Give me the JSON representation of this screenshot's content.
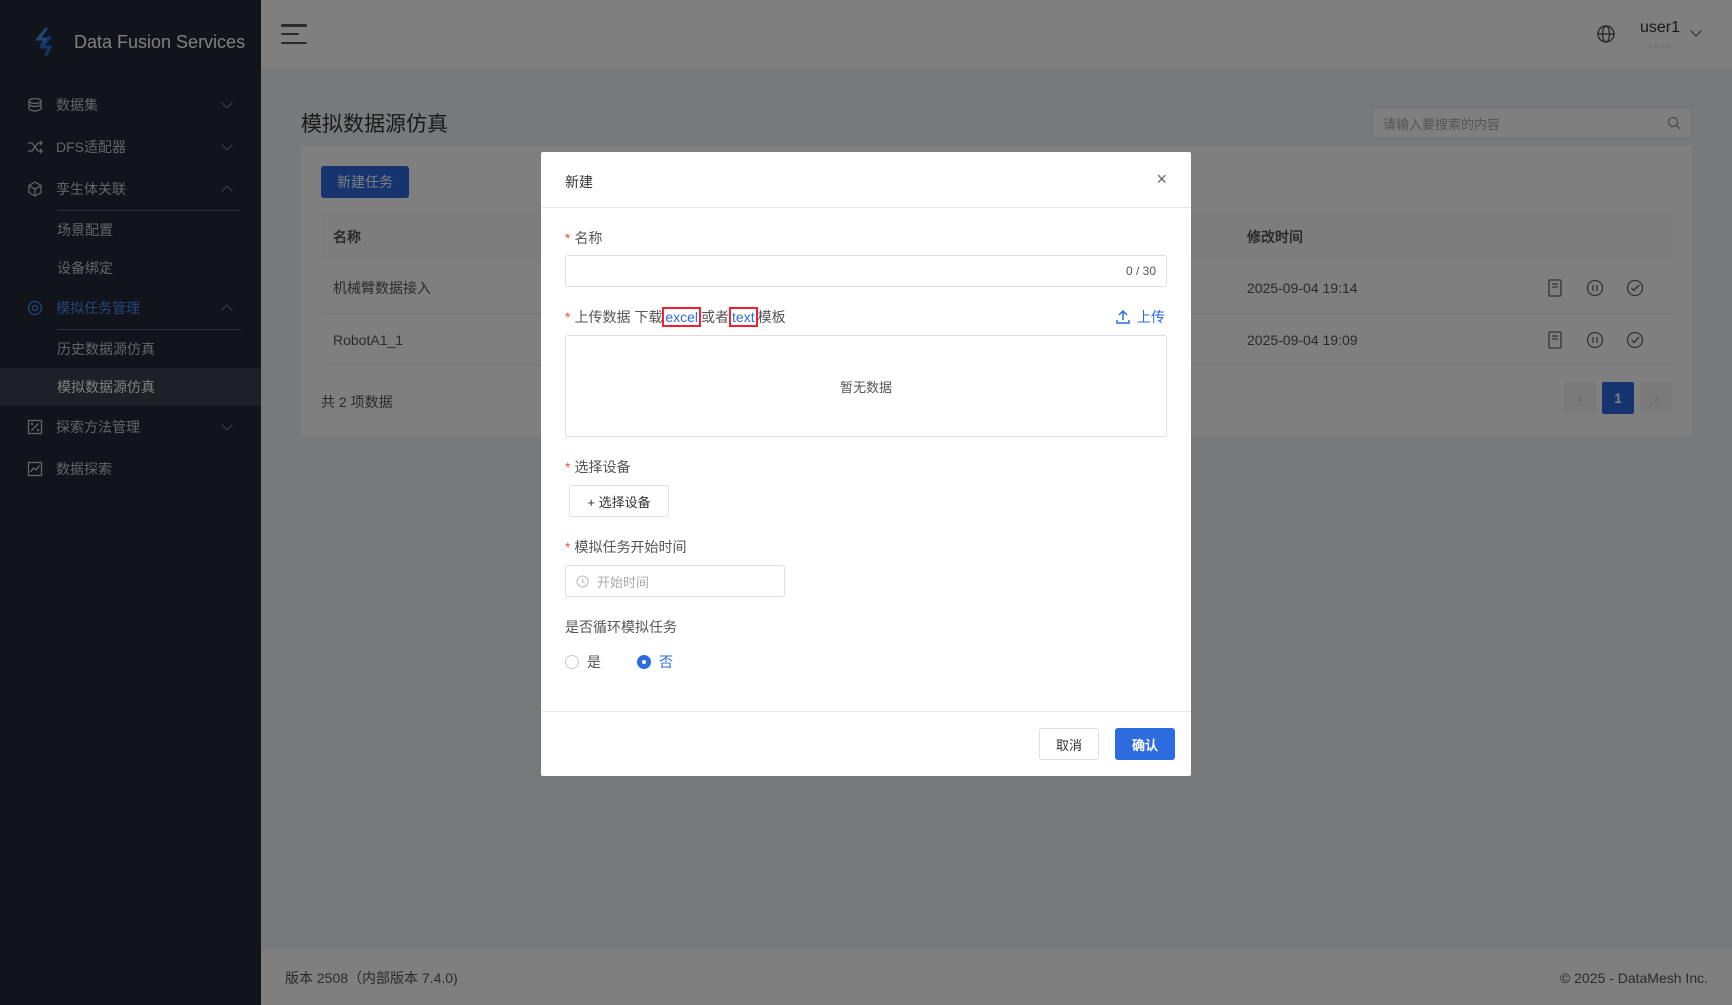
{
  "sidebar": {
    "brand": "Data Fusion Services",
    "items": [
      {
        "label": "数据集",
        "icon": "database-icon"
      },
      {
        "label": "DFS适配器",
        "icon": "shuffle-icon"
      },
      {
        "label": "孪生体关联",
        "icon": "cube-icon"
      },
      {
        "label": "场景配置"
      },
      {
        "label": "设备绑定"
      },
      {
        "label": "模拟任务管理",
        "icon": "simulation-icon"
      },
      {
        "label": "历史数据源仿真"
      },
      {
        "label": "模拟数据源仿真"
      },
      {
        "label": "探索方法管理",
        "icon": "percent-icon"
      },
      {
        "label": "数据探索",
        "icon": "chart-icon"
      }
    ]
  },
  "topbar": {
    "user_name": "user1",
    "user_sub": "○○○○"
  },
  "page": {
    "title": "模拟数据源仿真",
    "search_placeholder": "请输入要搜索的内容",
    "new_button": "新建任务",
    "columns": {
      "name": "名称",
      "modified": "修改时间"
    },
    "rows": [
      {
        "name": "机械臂数据接入",
        "modified": "2025-09-04 19:14"
      },
      {
        "name": "RobotA1_1",
        "modified": "2025-09-04 19:09"
      }
    ],
    "total": "共 2 项数据",
    "pager": {
      "prev": "‹",
      "current": "1",
      "next": "›"
    }
  },
  "footer": {
    "version": "版本 2508（内部版本 7.4.0)",
    "copyright": "© 2025 - DataMesh Inc."
  },
  "dialog": {
    "title": "新建",
    "close": "×",
    "name_label": "名称",
    "name_count": "0 / 30",
    "upload_label_prefix": "上传数据 下载",
    "excel_link": "excel",
    "or_text": "或者",
    "text_link": "text",
    "template_text": "模板",
    "upload_button": "上传",
    "upload_empty": "暂无数据",
    "device_label": "选择设备",
    "device_button": "+ 选择设备",
    "start_time_label": "模拟任务开始时间",
    "start_time_placeholder": "开始时间",
    "loop_label": "是否循环模拟任务",
    "loop_yes": "是",
    "loop_no": "否",
    "loop_value": "否",
    "cancel": "取消",
    "confirm": "确认"
  },
  "colors": {
    "primary": "#2c6be0",
    "sidebar_bg": "#232936",
    "active_nav": "#4d8cf5",
    "highlight_border": "#e22233"
  }
}
